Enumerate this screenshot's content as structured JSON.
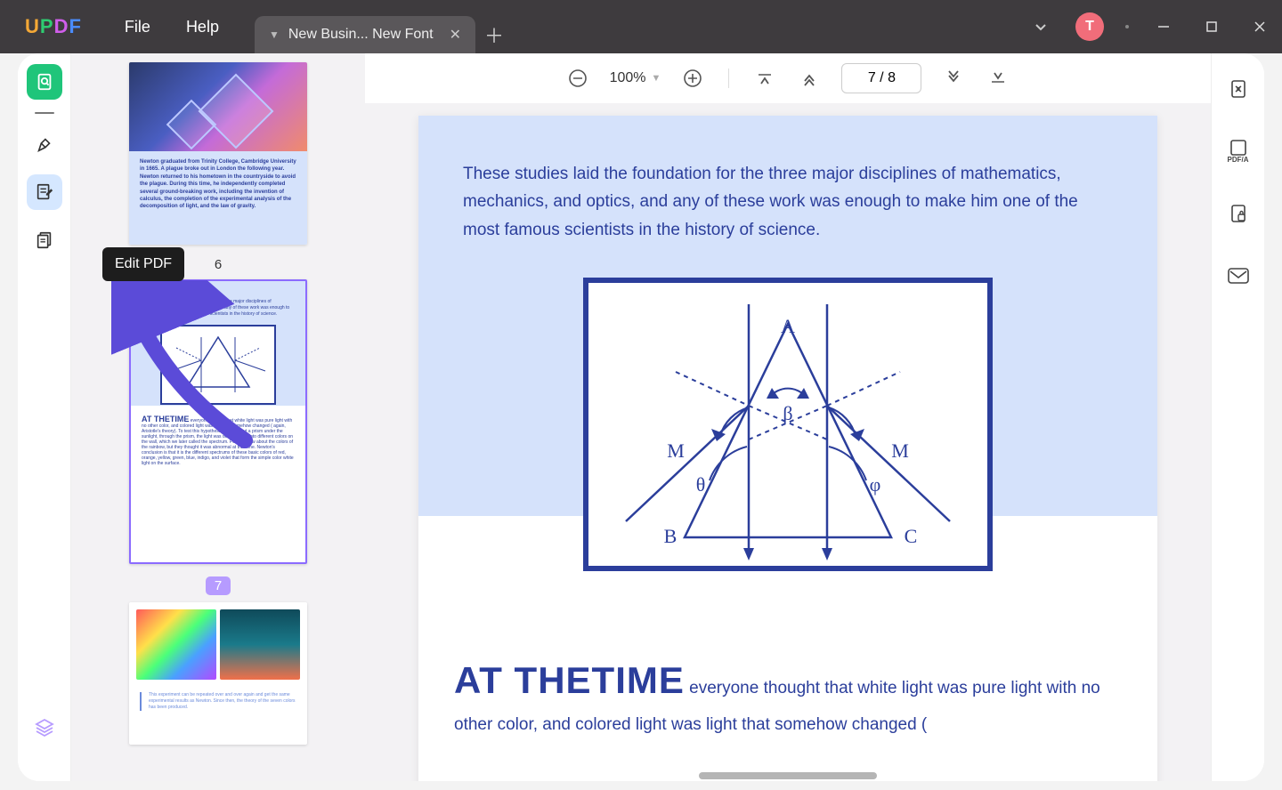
{
  "app": {
    "logo_letters": [
      "U",
      "P",
      "D",
      "F"
    ]
  },
  "menu": {
    "file": "File",
    "help": "Help"
  },
  "tab": {
    "title": "New Busin... New Font"
  },
  "titlebar": {
    "avatar_initial": "T"
  },
  "leftrail": {
    "tooltip": "Edit PDF"
  },
  "thumbnails": {
    "page6_label": "6",
    "page7_label": "7",
    "page7_heading": "AT THETIME"
  },
  "toolbar": {
    "zoom": "100%",
    "page_indicator": "7 / 8"
  },
  "document": {
    "para1": "These studies laid the foundation for the three major disciplines of mathematics, mechanics, and optics, and any of these work was enough to make him one of the most famous scientists in the history of science.",
    "diagram": {
      "label_A": "A",
      "label_B": "B",
      "label_C": "C",
      "label_M_left": "M",
      "label_M_right": "M",
      "label_beta": "β",
      "label_theta": "θ",
      "label_phi": "φ"
    },
    "heading2": "AT THETIME",
    "para2": "everyone thought that white light was pure light with no other color, and colored light was light that somehow changed ("
  },
  "rightrail": {
    "pdfa_label": "PDF/A"
  }
}
